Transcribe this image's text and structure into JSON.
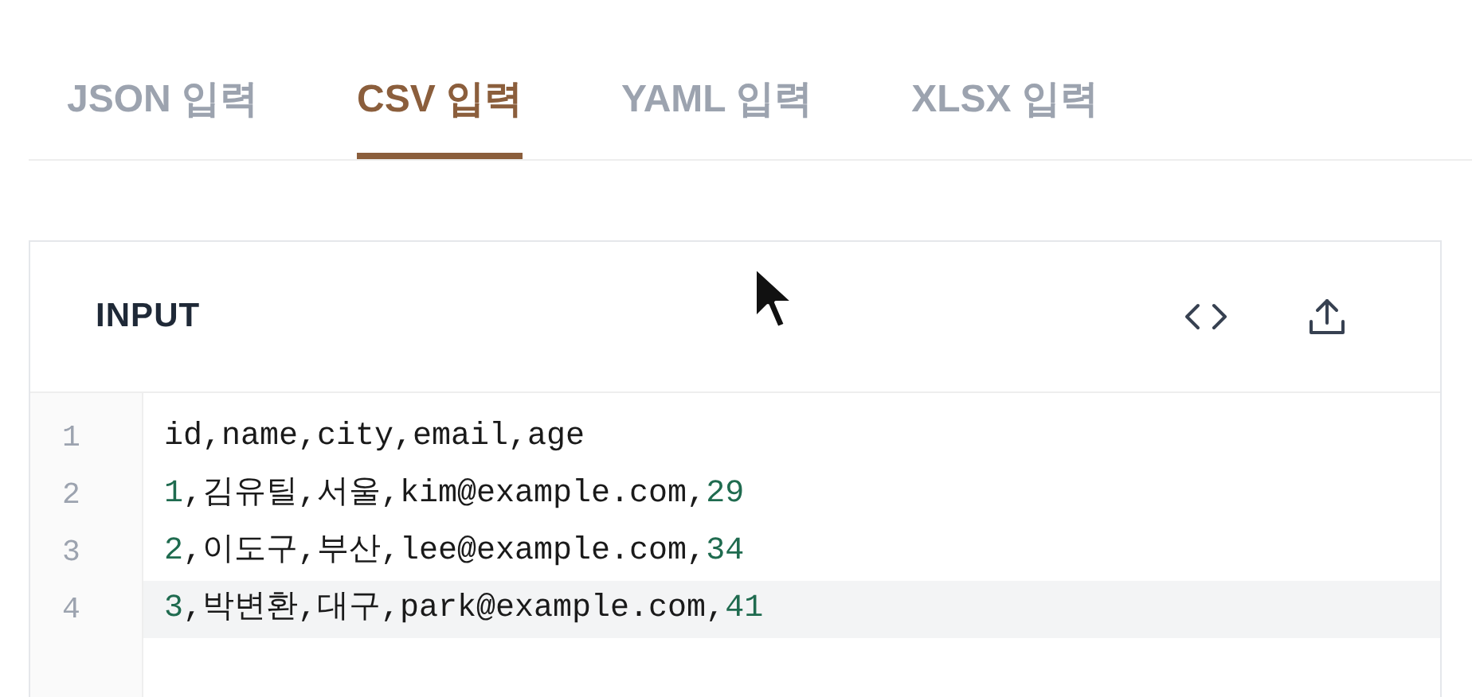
{
  "tabs": [
    {
      "label": "JSON 입력",
      "selected": false
    },
    {
      "label": "CSV 입력",
      "selected": true
    },
    {
      "label": "YAML 입력",
      "selected": false
    },
    {
      "label": "XLSX 입력",
      "selected": false
    }
  ],
  "panel": {
    "title": "INPUT",
    "lines": [
      {
        "number": "1",
        "active": false,
        "tokens": [
          {
            "kind": "text",
            "text": "id,name,city,email,age"
          }
        ]
      },
      {
        "number": "2",
        "active": false,
        "tokens": [
          {
            "kind": "number",
            "text": "1"
          },
          {
            "kind": "text",
            "text": ",김유틸,서울,kim@example.com,"
          },
          {
            "kind": "number",
            "text": "29"
          }
        ]
      },
      {
        "number": "3",
        "active": false,
        "tokens": [
          {
            "kind": "number",
            "text": "2"
          },
          {
            "kind": "text",
            "text": ",이도구,부산,lee@example.com,"
          },
          {
            "kind": "number",
            "text": "34"
          }
        ]
      },
      {
        "number": "4",
        "active": true,
        "tokens": [
          {
            "kind": "number",
            "text": "3"
          },
          {
            "kind": "text",
            "text": ",박변환,대구,park@example.com,"
          },
          {
            "kind": "number",
            "text": "41"
          }
        ]
      }
    ]
  }
}
